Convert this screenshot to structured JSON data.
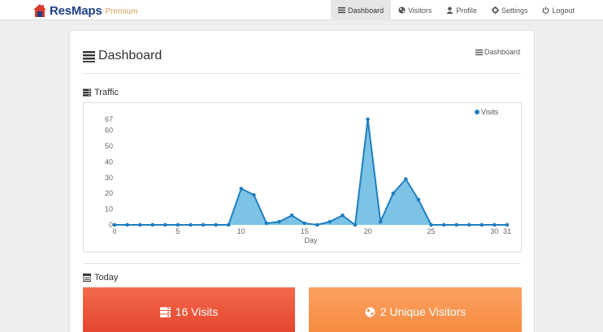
{
  "brand": {
    "name": "ResMaps",
    "tag": "Premium"
  },
  "nav": {
    "items": [
      {
        "label": "Dashboard",
        "icon": "list-icon",
        "active": true
      },
      {
        "label": "Visitors",
        "icon": "globe-icon",
        "active": false
      },
      {
        "label": "Profile",
        "icon": "user-icon",
        "active": false
      },
      {
        "label": "Settings",
        "icon": "gear-icon",
        "active": false
      },
      {
        "label": "Logout",
        "icon": "power-icon",
        "active": false
      }
    ]
  },
  "page": {
    "title": "Dashboard",
    "breadcrumb": "Dashboard"
  },
  "traffic": {
    "title": "Traffic"
  },
  "today": {
    "title": "Today",
    "visits_label": "16 Visits",
    "unique_label": "2 Unique Visitors"
  },
  "colors": {
    "series": "#1f7fbf",
    "fill": "#7cc3e6",
    "visits_box": "#ec5538",
    "unique_box": "#f9934c"
  },
  "chart_data": {
    "type": "area",
    "xlabel": "Day",
    "ylabel": "",
    "legend": [
      "Visits"
    ],
    "legend_position": "top-right",
    "grid": false,
    "x_ticks": [
      0,
      5,
      10,
      15,
      20,
      25,
      30,
      31
    ],
    "y_ticks": [
      0,
      10,
      20,
      30,
      40,
      50,
      60,
      67
    ],
    "xlim": [
      0,
      31
    ],
    "ylim": [
      0,
      67
    ],
    "x": [
      0,
      1,
      2,
      3,
      4,
      5,
      6,
      7,
      8,
      9,
      10,
      11,
      12,
      13,
      14,
      15,
      16,
      17,
      18,
      19,
      20,
      21,
      22,
      23,
      24,
      25,
      26,
      27,
      28,
      29,
      30,
      31
    ],
    "series": [
      {
        "name": "Visits",
        "values": [
          0,
          0,
          0,
          0,
          0,
          0,
          0,
          0,
          0,
          0,
          23,
          19,
          1,
          2,
          6,
          1,
          0,
          2,
          6,
          0,
          67,
          2,
          20,
          29,
          16,
          0,
          0,
          0,
          0,
          0,
          0,
          0
        ]
      }
    ]
  }
}
